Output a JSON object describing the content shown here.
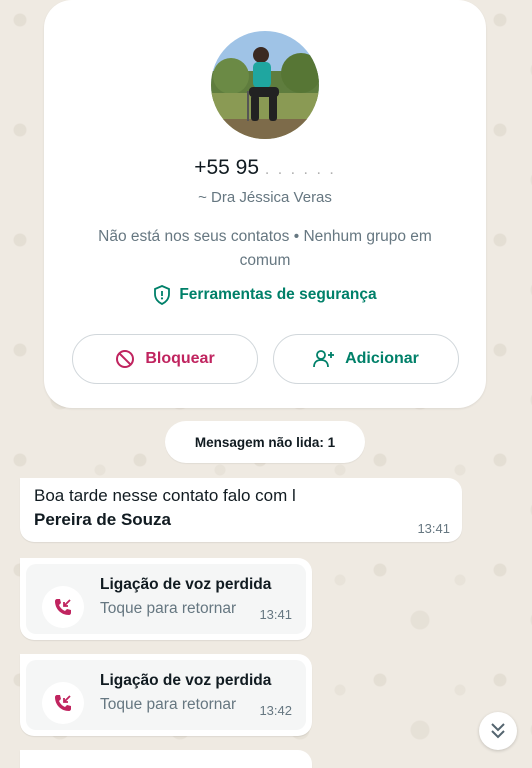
{
  "contact_card": {
    "phone_visible": "+55 95",
    "phone_hidden": ". . . . . .",
    "pushname": "~ Dra Jéssica Veras",
    "not_in_contacts": "Não está nos seus contatos • Nenhum grupo em comum",
    "safety_tools": "Ferramentas de segurança",
    "block_label": "Bloquear",
    "add_label": "Adicionar"
  },
  "unread_banner": "Mensagem não lida: 1",
  "messages": [
    {
      "line1": "Boa tarde nesse contato falo com l",
      "line2": "Pereira de Souza",
      "time": "13:41"
    }
  ],
  "missed_calls": [
    {
      "title": "Ligação de voz perdida",
      "subtitle": "Toque para retornar",
      "time": "13:41"
    },
    {
      "title": "Ligação de voz perdida",
      "subtitle": "Toque para retornar",
      "time": "13:42"
    }
  ],
  "colors": {
    "wallpaper": "#efeae2",
    "accent_green": "#008069",
    "danger": "#c0245f",
    "missed_call": "#c0245f"
  },
  "icons": [
    "avatar-photo",
    "shield-icon",
    "block-icon",
    "add-person-icon",
    "missed-call-icon",
    "double-chevron-down-icon"
  ]
}
